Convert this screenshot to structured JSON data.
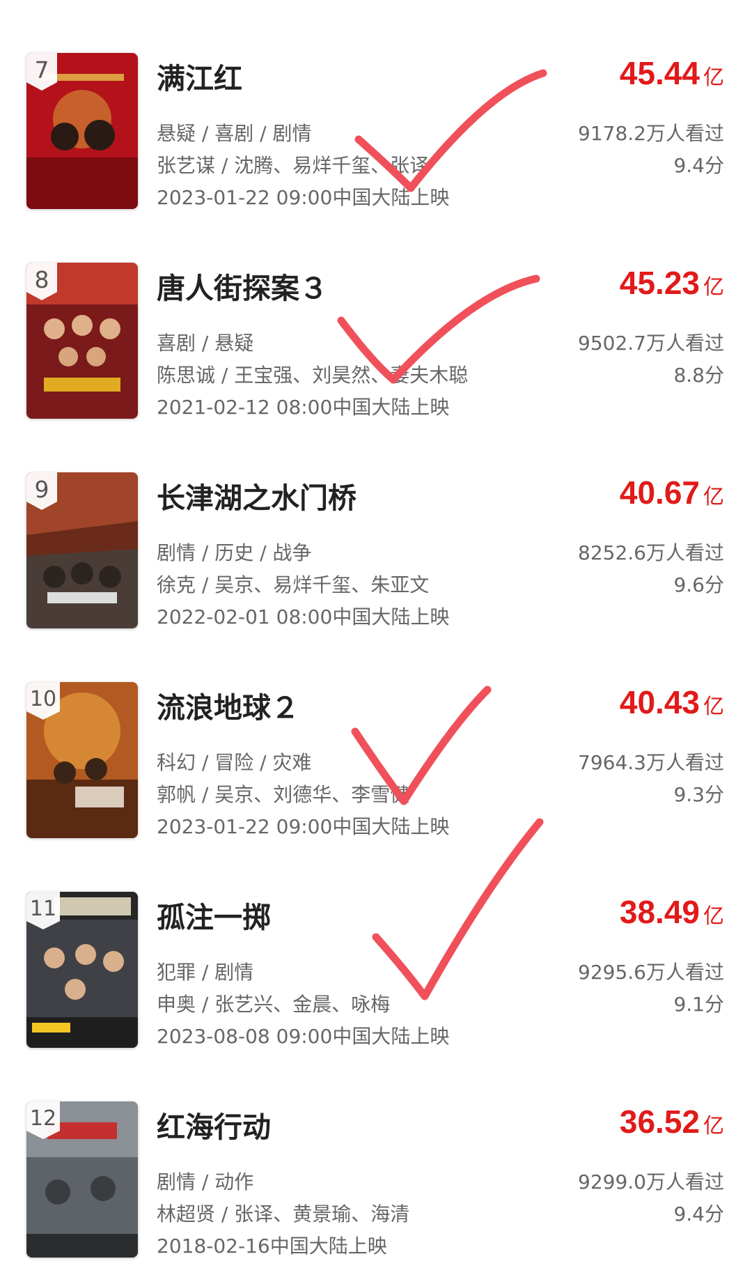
{
  "box_unit": "亿",
  "movies": [
    {
      "rank": "7",
      "title": "满江红",
      "genre": "悬疑 / 喜剧 / 剧情",
      "cast": "张艺谋 / 沈腾、易烊千玺、张译",
      "release": "2023-01-22 09:00中国大陆上映",
      "box_office": "45.44",
      "viewers": "9178.2万人看过",
      "score": "9.4分"
    },
    {
      "rank": "8",
      "title": "唐人街探案３",
      "genre": "喜剧 / 悬疑",
      "cast": "陈思诚 / 王宝强、刘昊然、妻夫木聪",
      "release": "2021-02-12 08:00中国大陆上映",
      "box_office": "45.23",
      "viewers": "9502.7万人看过",
      "score": "8.8分"
    },
    {
      "rank": "9",
      "title": "长津湖之水门桥",
      "genre": "剧情 / 历史 / 战争",
      "cast": "徐克 / 吴京、易烊千玺、朱亚文",
      "release": "2022-02-01 08:00中国大陆上映",
      "box_office": "40.67",
      "viewers": "8252.6万人看过",
      "score": "9.6分"
    },
    {
      "rank": "10",
      "title": "流浪地球２",
      "genre": "科幻 / 冒险 / 灾难",
      "cast": "郭帆 / 吴京、刘德华、李雪健",
      "release": "2023-01-22 09:00中国大陆上映",
      "box_office": "40.43",
      "viewers": "7964.3万人看过",
      "score": "9.3分"
    },
    {
      "rank": "11",
      "title": "孤注一掷",
      "genre": "犯罪 / 剧情",
      "cast": "申奥 / 张艺兴、金晨、咏梅",
      "release": "2023-08-08 09:00中国大陆上映",
      "box_office": "38.49",
      "viewers": "9295.6万人看过",
      "score": "9.1分"
    },
    {
      "rank": "12",
      "title": "红海行动",
      "genre": "剧情 / 动作",
      "cast": "林超贤 / 张译、黄景瑜、海清",
      "release": "2018-02-16中国大陆上映",
      "box_office": "36.52",
      "viewers": "9299.0万人看过",
      "score": "9.4分"
    }
  ],
  "colors": {
    "box_office": "#e11a1a",
    "check_mark": "#f0505a",
    "poster_bgs": [
      "#b3121a",
      "#7a1a1a",
      "#4a3d38",
      "#b35a22",
      "#3f4146",
      "#5d6368"
    ]
  }
}
